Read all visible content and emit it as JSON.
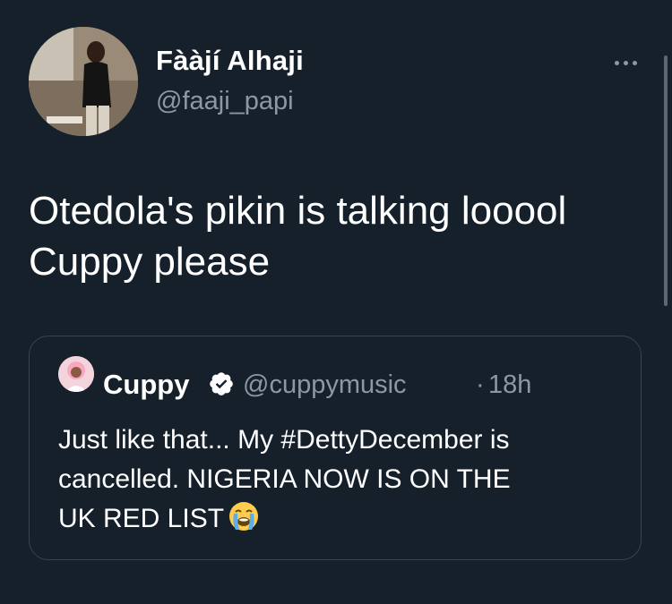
{
  "tweet": {
    "author": {
      "display_name": "Fààjí Alhaji",
      "handle": "@faaji_papi"
    },
    "more_icon": "more-horizontal-icon",
    "text_lines": [
      "Otedola's pikin is talking looool",
      "Cuppy please"
    ]
  },
  "quoted_tweet": {
    "author": {
      "display_name": "Cuppy",
      "verified": true,
      "handle": "@cuppymusic"
    },
    "separator": "·",
    "time": "18h",
    "text_lines": [
      "Just like that... My #DettyDecember is",
      "cancelled. NIGERIA NOW IS ON THE",
      "UK RED LIST"
    ],
    "emoji": "loudly-crying-face"
  },
  "colors": {
    "background": "#15202b",
    "text_primary": "#ffffff",
    "text_secondary": "#8b98a5",
    "border": "#38444d"
  }
}
